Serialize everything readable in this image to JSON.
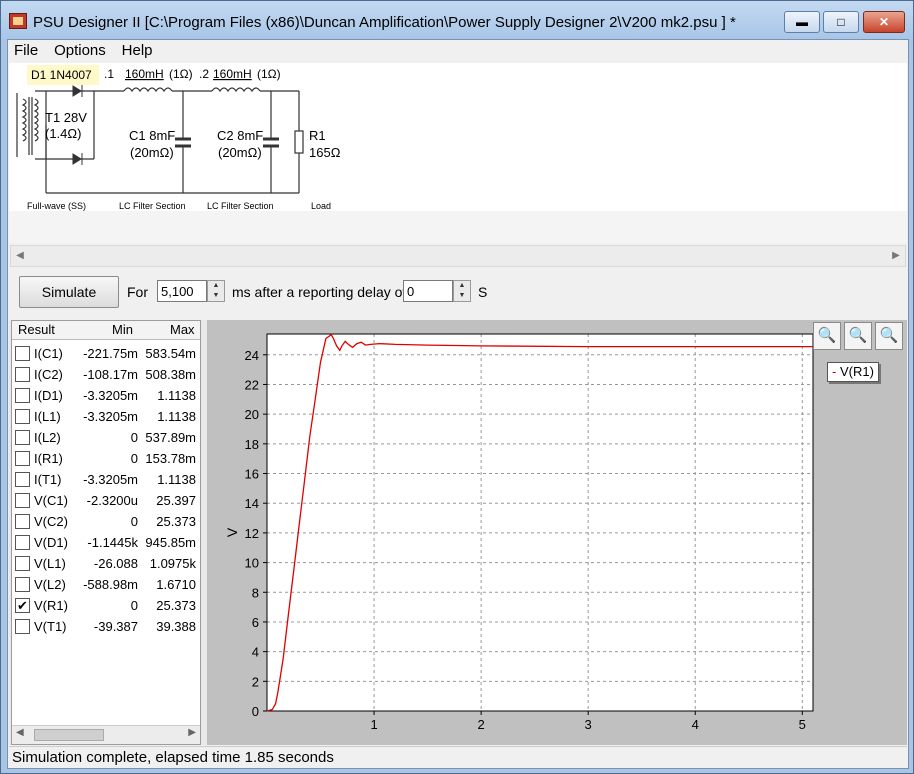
{
  "window": {
    "title": "PSU Designer II  [C:\\Program Files (x86)\\Duncan Amplification\\Power Supply Designer 2\\V200 mk2.psu ] *",
    "minimize_icon": "minimize-icon",
    "maximize_icon": "maximize-icon",
    "close_icon": "close-icon"
  },
  "menu": {
    "items": [
      "File",
      "Options",
      "Help"
    ]
  },
  "schematic": {
    "d1": "D1 1N4007",
    "t1": "T1 28V",
    "t1r": "(1.4Ω)",
    "node1": ".1",
    "node2": ".2",
    "l1": "160mH",
    "l1r": "(1Ω)",
    "l2": "160mH",
    "l2r": "(1Ω)",
    "c1": "C1 8mF",
    "c1r": "(20mΩ)",
    "c2": "C2 8mF",
    "c2r": "(20mΩ)",
    "r1": "R1",
    "r1v": "165Ω",
    "sec1": "Full-wave (SS)",
    "sec2": "LC Filter Section",
    "sec3": "LC Filter Section",
    "sec4": "Load"
  },
  "toolbar": {
    "simulate_label": "Simulate",
    "for_label": "For",
    "duration_value": "5,100",
    "ms_label": "ms  after a reporting delay of",
    "delay_value": "0",
    "s_label": "S"
  },
  "results": {
    "headers": {
      "result": "Result",
      "min": "Min",
      "max": "Max"
    },
    "rows": [
      {
        "name": "I(C1)",
        "min": "-221.75m",
        "max": "583.54m",
        "checked": false
      },
      {
        "name": "I(C2)",
        "min": "-108.17m",
        "max": "508.38m",
        "checked": false
      },
      {
        "name": "I(D1)",
        "min": "-3.3205m",
        "max": "1.1138",
        "checked": false
      },
      {
        "name": "I(L1)",
        "min": "-3.3205m",
        "max": "1.1138",
        "checked": false
      },
      {
        "name": "I(L2)",
        "min": "0",
        "max": "537.89m",
        "checked": false
      },
      {
        "name": "I(R1)",
        "min": "0",
        "max": "153.78m",
        "checked": false
      },
      {
        "name": "I(T1)",
        "min": "-3.3205m",
        "max": "1.1138",
        "checked": false
      },
      {
        "name": "V(C1)",
        "min": "-2.3200u",
        "max": "25.397",
        "checked": false
      },
      {
        "name": "V(C2)",
        "min": "0",
        "max": "25.373",
        "checked": false
      },
      {
        "name": "V(D1)",
        "min": "-1.1445k",
        "max": "945.85m",
        "checked": false
      },
      {
        "name": "V(L1)",
        "min": "-26.088",
        "max": "1.0975k",
        "checked": false
      },
      {
        "name": "V(L2)",
        "min": "-588.98m",
        "max": "1.6710",
        "checked": false
      },
      {
        "name": "V(R1)",
        "min": "0",
        "max": "25.373",
        "checked": true
      },
      {
        "name": "V(T1)",
        "min": "-39.387",
        "max": "39.388",
        "checked": false
      }
    ]
  },
  "plot": {
    "zoom_icons": [
      "zoom-in-icon",
      "zoom-out-icon",
      "zoom-reset-icon"
    ],
    "legend": "V(R1)",
    "colors": {
      "trace": "#e00000",
      "plot_bg": "#ffffff",
      "frame_bg": "#c0c0c0"
    }
  },
  "chart_data": {
    "type": "line",
    "title": "",
    "xlabel": "",
    "ylabel": "V",
    "xlim": [
      0,
      5.1
    ],
    "ylim": [
      0,
      25.4
    ],
    "xticks": [
      1,
      2,
      3,
      4,
      5
    ],
    "yticks": [
      0,
      2,
      4,
      6,
      8,
      10,
      12,
      14,
      16,
      18,
      20,
      22,
      24
    ],
    "grid": true,
    "legend_position": "top-right",
    "series": [
      {
        "name": "V(R1)",
        "color": "#e00000",
        "x": [
          0.0,
          0.05,
          0.08,
          0.1,
          0.15,
          0.2,
          0.25,
          0.3,
          0.35,
          0.4,
          0.45,
          0.5,
          0.55,
          0.6,
          0.62,
          0.65,
          0.68,
          0.7,
          0.73,
          0.76,
          0.8,
          0.84,
          0.88,
          0.92,
          0.97,
          1.05,
          1.2,
          1.5,
          2.0,
          3.0,
          4.0,
          5.1
        ],
        "y": [
          0.0,
          0.1,
          0.5,
          1.2,
          3.5,
          6.5,
          9.5,
          12.5,
          15.5,
          18.5,
          21.0,
          23.5,
          25.1,
          25.35,
          25.1,
          24.6,
          24.3,
          24.6,
          24.9,
          24.7,
          24.5,
          24.75,
          24.85,
          24.65,
          24.7,
          24.75,
          24.7,
          24.65,
          24.6,
          24.55,
          24.55,
          24.55
        ]
      }
    ]
  },
  "status": {
    "text": "Simulation complete, elapsed time 1.85 seconds"
  }
}
